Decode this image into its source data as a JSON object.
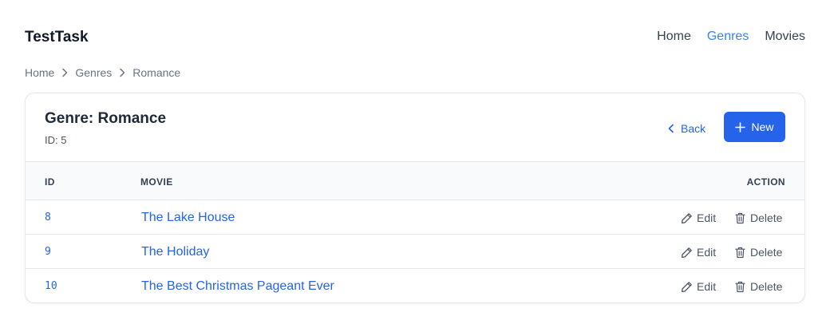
{
  "header": {
    "brand": "TestTask",
    "nav": [
      {
        "label": "Home",
        "active": false
      },
      {
        "label": "Genres",
        "active": true
      },
      {
        "label": "Movies",
        "active": false
      }
    ]
  },
  "breadcrumb": [
    "Home",
    "Genres",
    "Romance"
  ],
  "card": {
    "title": "Genre: Romance",
    "subtitle": "ID: 5",
    "back_label": "Back",
    "new_label": "New"
  },
  "table": {
    "columns": [
      "ID",
      "MOVIE",
      "ACTION"
    ],
    "rows": [
      {
        "id": "8",
        "movie": "The Lake House"
      },
      {
        "id": "9",
        "movie": "The Holiday"
      },
      {
        "id": "10",
        "movie": "The Best Christmas Pageant Ever"
      }
    ],
    "edit_label": "Edit",
    "delete_label": "Delete"
  },
  "colors": {
    "accent": "#2563eb",
    "nav_active": "#3b82f6",
    "muted": "#6b7280"
  }
}
